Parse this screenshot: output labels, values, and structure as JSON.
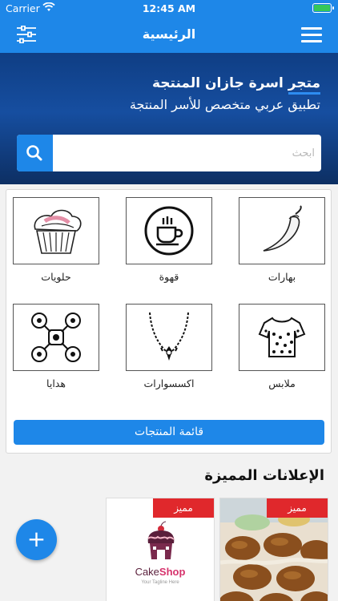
{
  "status": {
    "carrier": "Carrier",
    "time": "12:45 AM"
  },
  "nav": {
    "title": "الرئيسية"
  },
  "hero": {
    "heading": "متجر اسرة جازان المنتجة",
    "subheading": "تطبيق عربي متخصص للأسر المنتجة"
  },
  "search": {
    "placeholder": "ابحث"
  },
  "categories": [
    {
      "label": "بهارات",
      "icon": "pepper-icon"
    },
    {
      "label": "قهوة",
      "icon": "coffee-cup-icon"
    },
    {
      "label": "حلويات",
      "icon": "cupcake-icon"
    },
    {
      "label": "ملابس",
      "icon": "shirt-icon"
    },
    {
      "label": "اكسسوارات",
      "icon": "necklace-icon"
    },
    {
      "label": "هدايا",
      "icon": "drone-icon"
    }
  ],
  "products_button": "قائمة المنتجات",
  "featured": {
    "title": "الإعلانات المميزة",
    "ads": [
      {
        "badge": "مميز",
        "image": "pastry-photo"
      },
      {
        "badge": "مميز",
        "image": "cakeshop-logo",
        "logo_text_1": "Cake",
        "logo_text_2": "Shop",
        "logo_sub": "Your Tagline Here"
      }
    ]
  },
  "fab": "+",
  "colors": {
    "primary": "#1e87e8",
    "hero_dark": "#0f3e84",
    "badge": "#e0282c"
  }
}
